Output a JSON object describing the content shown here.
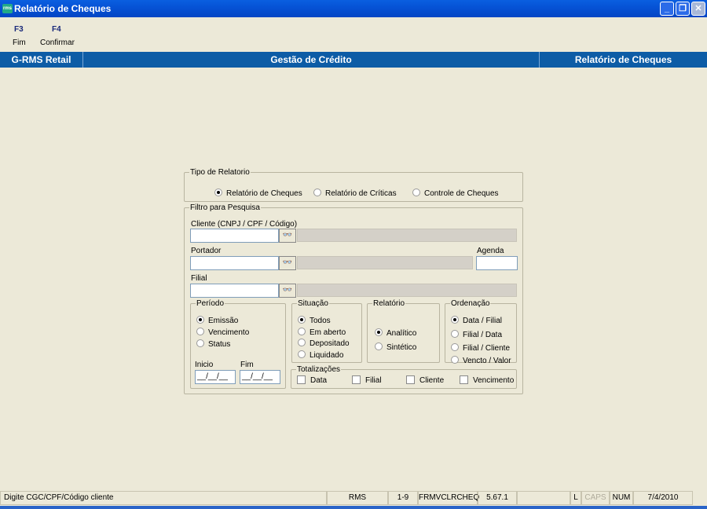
{
  "window": {
    "title": "Relatório de Cheques",
    "icon": "rms-app-icon"
  },
  "toolbar": [
    {
      "key": "F3",
      "label": "Fim"
    },
    {
      "key": "F4",
      "label": "Confirmar"
    }
  ],
  "header": {
    "left": "G-RMS Retail",
    "center": "Gestão de Crédito",
    "right": "Relatório de Cheques"
  },
  "tipo": {
    "legend": "Tipo de Relatorio",
    "options": [
      "Relatório de Cheques",
      "Relatório de Críticas",
      "Controle de Cheques"
    ],
    "selected": 0
  },
  "filtro": {
    "legend": "Filtro para Pesquisa",
    "cliente_label": "Cliente (CNPJ / CPF / Código)",
    "cliente_value": "",
    "portador_label": "Portador",
    "portador_value": "",
    "agenda_label": "Agenda",
    "agenda_value": "",
    "filial_label": "Filial",
    "filial_value": ""
  },
  "periodo": {
    "legend": "Período",
    "options": [
      "Emissão",
      "Vencimento",
      "Status"
    ],
    "selected": 0,
    "inicio_label": "Inicio",
    "inicio_value": "__/__/__",
    "fim_label": "Fim",
    "fim_value": "__/__/__"
  },
  "situacao": {
    "legend": "Situação",
    "options": [
      "Todos",
      "Em aberto",
      "Depositado",
      "Liquidado"
    ],
    "selected": 0
  },
  "relatorio": {
    "legend": "Relatório",
    "options": [
      "Analítico",
      "Sintético"
    ],
    "selected": 0
  },
  "ordenacao": {
    "legend": "Ordenação",
    "options": [
      "Data / Filial",
      "Filial / Data",
      "Filial / Cliente",
      "Vencto / Valor"
    ],
    "selected": 0
  },
  "totalizacoes": {
    "legend": "Totalizações",
    "options": [
      "Data",
      "Filial",
      "Cliente",
      "Vencimento"
    ],
    "checked": [
      false,
      false,
      false,
      false
    ]
  },
  "status": {
    "hint": "Digite CGC/CPF/Código cliente",
    "system": "RMS",
    "range": "1-9",
    "form": "FRMVCLRCHEQ",
    "version": "5.67.1",
    "extra": "",
    "l": "L",
    "caps": "CAPS",
    "num": "NUM",
    "date": "7/4/2010"
  },
  "colors": {
    "header": "#0d5ca6",
    "background": "#ece9d8"
  }
}
